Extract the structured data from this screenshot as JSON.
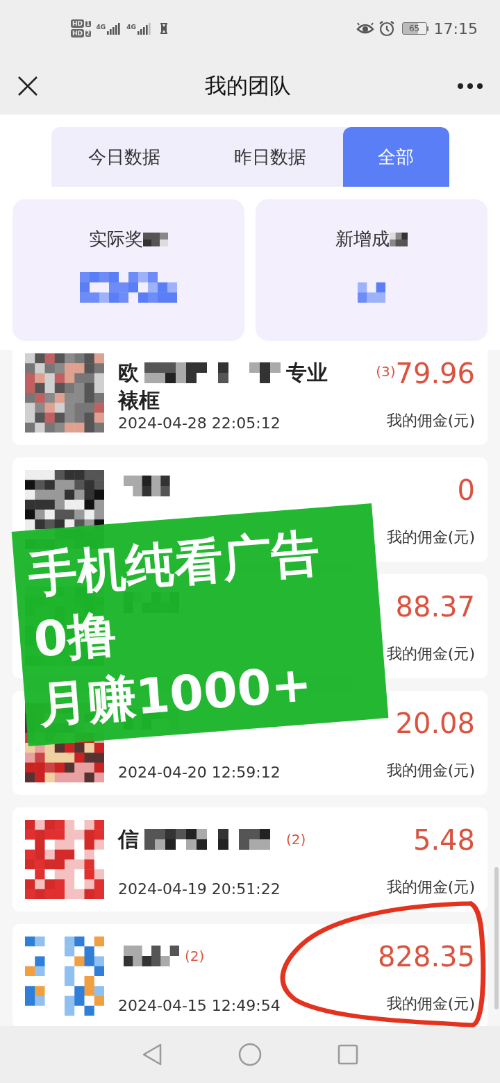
{
  "status_bar": {
    "sims": [
      {
        "label": "HD",
        "slot": "1"
      },
      {
        "label": "HD",
        "slot": "2"
      }
    ],
    "networks": [
      "4G",
      "4G"
    ],
    "battery": "65",
    "time": "17:15"
  },
  "header": {
    "title": "我的团队"
  },
  "tabs": [
    {
      "label": "今日数据",
      "selected": false
    },
    {
      "label": "昨日数据",
      "selected": false
    },
    {
      "label": "全部",
      "selected": true
    }
  ],
  "stats": [
    {
      "label": "实际奖"
    },
    {
      "label": "新增成"
    }
  ],
  "records": [
    {
      "name": [
        [
          {
            "kind": "text",
            "text": "欧"
          },
          {
            "kind": "mosaic"
          },
          {
            "kind": "mosaic"
          },
          {
            "kind": "text",
            "text": "专业"
          }
        ],
        [
          {
            "kind": "text",
            "text": "裱框"
          }
        ]
      ],
      "amount_badge": "(3)",
      "amount": "79.96",
      "amount_label": "我的佣金(元)",
      "date": "2024-04-28 22:05:12"
    },
    {
      "name": [
        [
          {
            "kind": "mosaic"
          }
        ]
      ],
      "amount": "0",
      "amount_label": "我的佣金(元)"
    },
    {
      "name": [
        [
          {
            "kind": "mosaic"
          }
        ]
      ],
      "amount": "88.37",
      "amount_label": "我的佣金(元)"
    },
    {
      "name": [
        [
          {
            "kind": "mosaic"
          }
        ]
      ],
      "amount": "20.08",
      "amount_label": "我的佣金(元)",
      "date": "2024-04-20 12:59:12"
    },
    {
      "name": [
        [
          {
            "kind": "text",
            "text": "信"
          },
          {
            "kind": "mosaic"
          },
          {
            "kind": "mosaic"
          }
        ]
      ],
      "name_badge": "(2)",
      "amount": "5.48",
      "amount_label": "我的佣金(元)",
      "date": "2024-04-19 20:51:22"
    },
    {
      "name": [
        [
          {
            "kind": "mosaic"
          }
        ]
      ],
      "name_badge": "(2)",
      "amount": "828.35",
      "amount_label": "我的佣金(元)",
      "date": "2024-04-15 12:49:54"
    }
  ],
  "promo": {
    "lines": [
      "手机纯看广告",
      "0撸",
      "月赚1000+"
    ]
  }
}
